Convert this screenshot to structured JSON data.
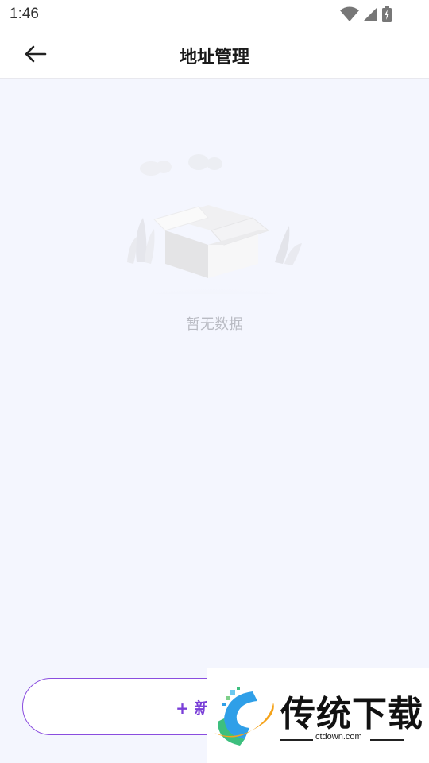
{
  "status_bar": {
    "time": "1:46",
    "icons": [
      "wifi-icon",
      "signal-icon",
      "battery-charging-icon"
    ]
  },
  "header": {
    "back_icon": "arrow-left-icon",
    "title": "地址管理"
  },
  "empty_state": {
    "illustration": "empty-box-icon",
    "text": "暂无数据"
  },
  "footer": {
    "add_button_label": "+ 新"
  },
  "watermark": {
    "title": "传统下载",
    "url": "ctdown.com"
  },
  "colors": {
    "accent": "#7a3fd8",
    "background": "#f4f6fe",
    "empty_text": "#b9bbc3"
  }
}
